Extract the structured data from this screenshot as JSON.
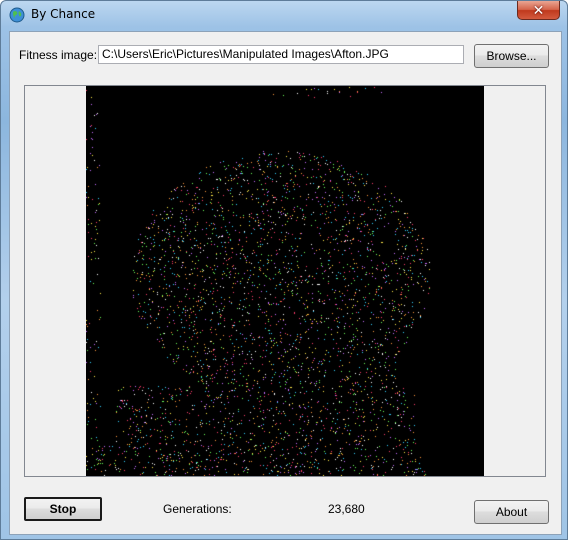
{
  "window": {
    "title": "By Chance",
    "app_icon": "globe-icon",
    "close_icon": "close-icon",
    "close_glyph": "✕"
  },
  "fitness": {
    "label": "Fitness image:",
    "path": "C:\\Users\\Eric\\Pictures\\Manipulated Images\\Afton.JPG",
    "browse_label": "Browse..."
  },
  "canvas": {
    "description_icon": "evolving-image",
    "colors": [
      "#ff3b6b",
      "#35d0ff",
      "#ffe94a",
      "#6cff5c",
      "#c86bff",
      "#ffffff",
      "#ff9a3c"
    ]
  },
  "footer": {
    "stop_label": "Stop",
    "generations_label": "Generations:",
    "generations_value": "23,680",
    "about_label": "About"
  }
}
